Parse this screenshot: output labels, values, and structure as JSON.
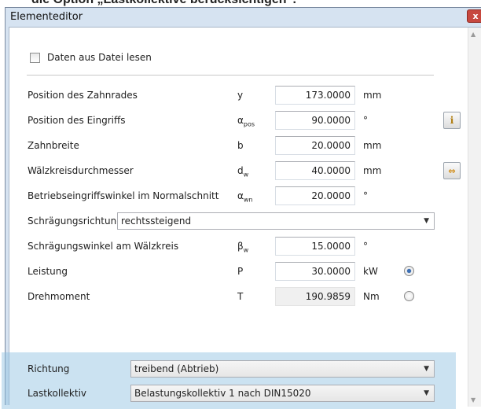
{
  "background_caption": "die Option „Lastkollektive berücksichtigen“.",
  "window": {
    "title": "Elementeditor",
    "close_label": "x"
  },
  "checkbox": {
    "label": "Daten aus Datei lesen",
    "checked": false
  },
  "rows": [
    {
      "label": "Position des Zahnrades",
      "symbol": "y",
      "symbol_sub": "",
      "value": "173.0000",
      "unit": "mm"
    },
    {
      "label": "Position des Eingriffs",
      "symbol": "α",
      "symbol_sub": "pos",
      "value": "90.0000",
      "unit": "°"
    },
    {
      "label": "Zahnbreite",
      "symbol": "b",
      "symbol_sub": "",
      "value": "20.0000",
      "unit": "mm"
    },
    {
      "label": "Wälzkreisdurchmesser",
      "symbol": "d",
      "symbol_sub": "w",
      "value": "40.0000",
      "unit": "mm"
    },
    {
      "label": "Betriebseingriffswinkel im Normalschnitt",
      "symbol": "α",
      "symbol_sub": "wn",
      "value": "20.0000",
      "unit": "°"
    }
  ],
  "schraegungsrichtung": {
    "label": "Schrägungsrichtung",
    "value": "rechtssteigend"
  },
  "schraegungswinkel": {
    "label": "Schrägungswinkel am Wälzkreis",
    "symbol": "β",
    "symbol_sub": "w",
    "value": "15.0000",
    "unit": "°"
  },
  "leistung": {
    "label": "Leistung",
    "symbol": "P",
    "value": "30.0000",
    "unit": "kW",
    "selected": true
  },
  "drehmoment": {
    "label": "Drehmoment",
    "symbol": "T",
    "value": "190.9859",
    "unit": "Nm",
    "selected": false
  },
  "richtung": {
    "label": "Richtung",
    "value": "treibend (Abtrieb)"
  },
  "lastkollektiv": {
    "label": "Lastkollektiv",
    "value": "Belastungskollektiv 1 nach DIN15020"
  },
  "icons": {
    "info": "info-icon",
    "swap": "swap-arrows-icon"
  },
  "colors": {
    "highlight": "#8cbee1",
    "radio_selected": "#3b6fb5"
  }
}
